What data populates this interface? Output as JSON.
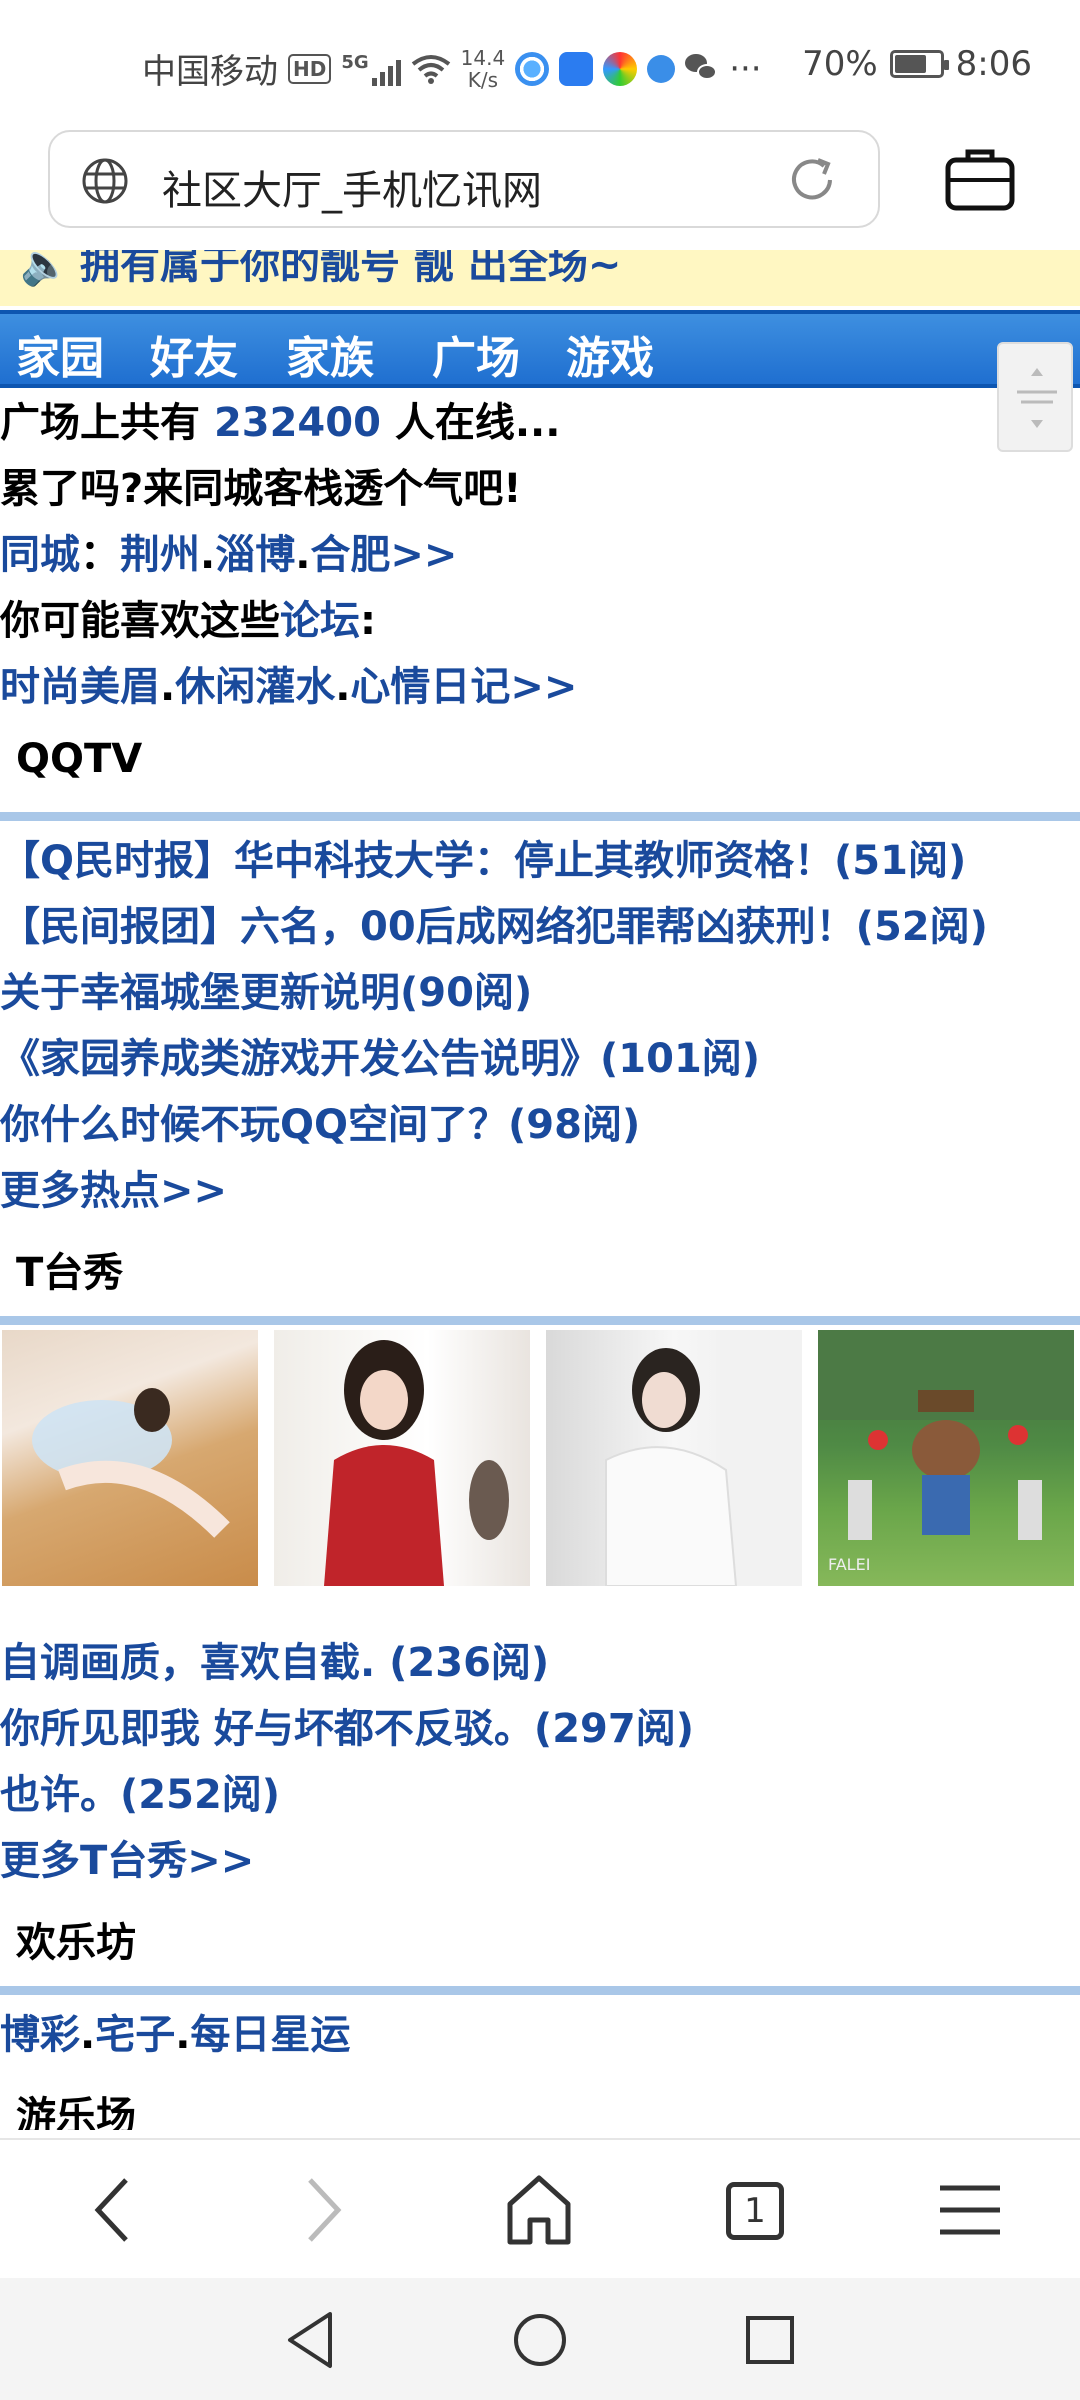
{
  "status_bar": {
    "carrier": "中国移动",
    "hd": "HD",
    "network": "5G",
    "speed_value": "14.4",
    "speed_unit": "K/s",
    "more": "···",
    "battery_percent": "70%",
    "battery_level": 0.7,
    "time": "8:06"
  },
  "address_bar": {
    "title": "社区大厅_手机忆讯网"
  },
  "notice": {
    "text": "拥有属于你的靓号 靓 出全场~"
  },
  "nav": [
    "家园",
    "好友",
    "家族",
    "广场",
    "游戏"
  ],
  "intro": {
    "online_prefix": "广场上共有 ",
    "online_count": "232400",
    "online_suffix": " 人在线...",
    "inn_line": "累了吗?来同城客栈透个气吧!",
    "city_label": "同城",
    "city_colon": "：",
    "city_1": "荆州",
    "city_2": "淄博",
    "city_3": "合肥>>",
    "forum_prefix": "你可能喜欢这些",
    "forum_label": "论坛",
    "forum_colon": ":",
    "forum_1": "时尚美眉",
    "forum_2": "休闲灌水",
    "forum_3": "心情日记>>"
  },
  "qqtv": {
    "title": "QQTV",
    "items": [
      "【Q民时报】华中科技大学：停止其教师资格！(51阅)",
      "【民间报团】六名，00后成网络犯罪帮凶获刑！(52阅)",
      "关于幸福城堡更新说明(90阅)",
      "《家园养成类游戏开发公告说明》(101阅)",
      "你什么时候不玩QQ空间了？(98阅)"
    ],
    "more": "更多热点>>"
  },
  "tshow": {
    "title": "T台秀",
    "photo_caption": "FALEI",
    "items": [
      "自调画质，喜欢自截. (236阅)",
      "你所见即我 好与坏都不反驳。(297阅)",
      "也许。(252阅)"
    ],
    "more": "更多T台秀>>"
  },
  "fun": {
    "title": "欢乐坊",
    "link_1": "博彩",
    "link_2": "宅子",
    "link_3": "每日星运"
  },
  "playground": {
    "title": "游乐场"
  },
  "toolbar": {
    "tabs_count": "1"
  },
  "colors": {
    "link_blue": "#1a4a9c",
    "nav_blue": "#2a7ad8",
    "notice_bg": "#fff7c2",
    "rule_blue": "#a9c7e8"
  }
}
